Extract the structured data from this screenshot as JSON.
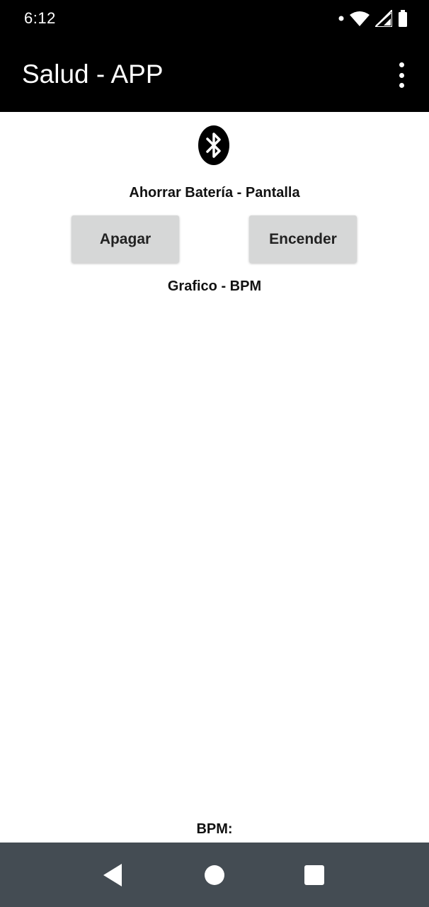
{
  "status_bar": {
    "time": "6:12",
    "icons": [
      "notification-dot-icon",
      "wifi-icon",
      "cell-signal-icon",
      "battery-icon"
    ]
  },
  "app_bar": {
    "title": "Salud - APP",
    "menu_icon": "overflow-menu-icon"
  },
  "content": {
    "bluetooth_icon": "bluetooth-icon",
    "battery_saver_label": "Ahorrar Batería - Pantalla",
    "off_button_label": "Apagar",
    "on_button_label": "Encender",
    "graph_label": "Grafico - BPM",
    "bpm_label": "BPM:"
  },
  "nav_bar": {
    "icons": [
      "back-icon",
      "home-icon",
      "recents-icon"
    ]
  },
  "colors": {
    "bar_background": "#000000",
    "nav_background": "#444c53",
    "button_background": "#d6d7d7",
    "text": "#111111"
  }
}
